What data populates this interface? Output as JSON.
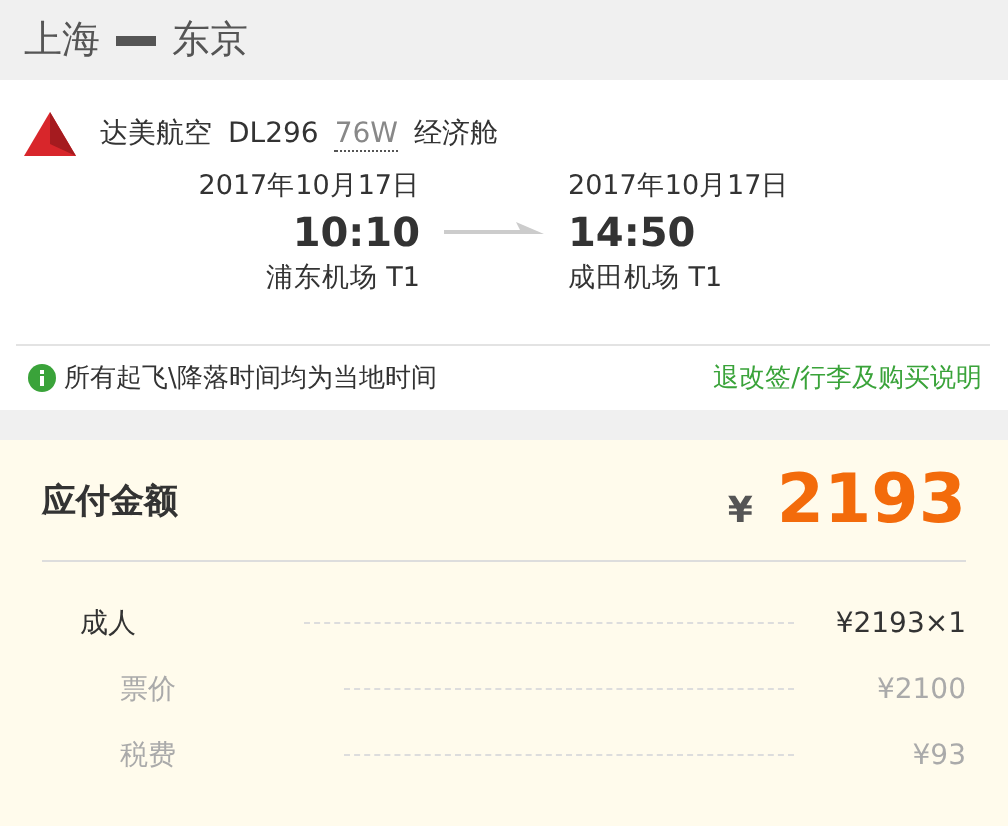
{
  "route": {
    "from": "上海",
    "to": "东京"
  },
  "flight": {
    "airline": "达美航空",
    "number": "DL296",
    "aircraft": "76W",
    "cabin": "经济舱",
    "departure": {
      "date": "2017年10月17日",
      "time": "10:10",
      "airport": "浦东机场 T1"
    },
    "arrival": {
      "date": "2017年10月17日",
      "time": "14:50",
      "airport": "成田机场 T1"
    },
    "note": "所有起飞\\降落时间均为当地时间",
    "policy_link": "退改签/行李及购买说明"
  },
  "payment": {
    "title": "应付金额",
    "currency": "¥",
    "amount": "2193",
    "rows": [
      {
        "kind": "main",
        "label": "成人",
        "value": "¥2193×1"
      },
      {
        "kind": "sub",
        "label": "票价",
        "value": "¥2100"
      },
      {
        "kind": "sub",
        "label": "税费",
        "value": "¥93"
      }
    ]
  }
}
